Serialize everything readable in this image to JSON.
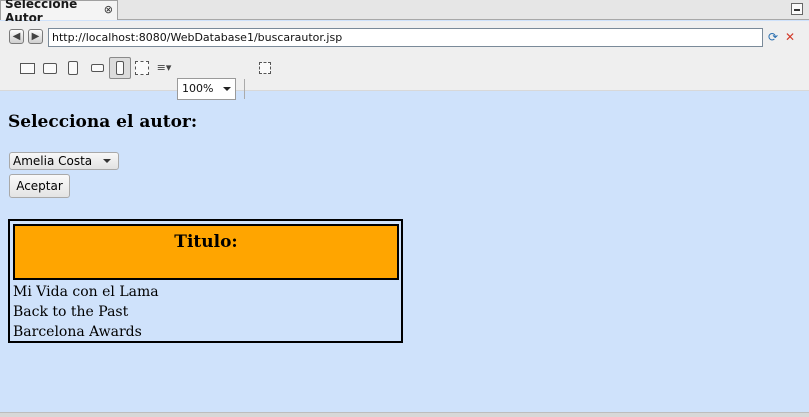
{
  "tab": {
    "title": "Seleccione Autor"
  },
  "toolbar": {
    "url": "http://localhost:8080/WebDatabase1/buscarautor.jsp",
    "zoom": "100%"
  },
  "page": {
    "heading": "Selecciona el autor:",
    "author_select": {
      "selected": "Amelia Costa"
    },
    "submit_label": "Aceptar",
    "results": {
      "header": "Titulo:",
      "rows": [
        "Mi Vida con el Lama",
        "Back to the Past",
        "Barcelona Awards"
      ]
    }
  },
  "colors": {
    "page_background": "#cfe2fb",
    "header_background": "#ffa500"
  }
}
